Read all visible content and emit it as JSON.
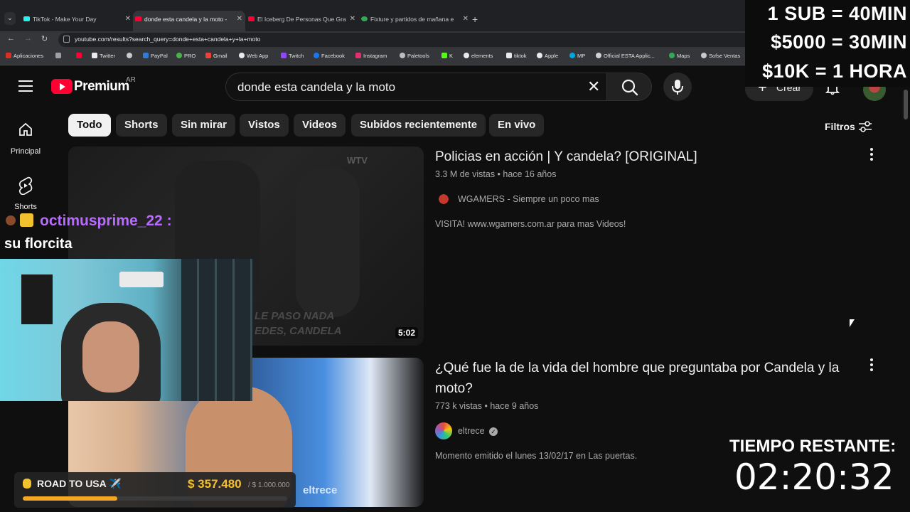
{
  "browser": {
    "tabs": [
      {
        "title": "TikTok - Make Your Day",
        "favicon_color": "#25f4ee",
        "active": false
      },
      {
        "title": "donde esta candela y la moto -",
        "favicon_color": "#ff0033",
        "active": true
      },
      {
        "title": "El Iceberg De Personas Que Gra",
        "favicon_color": "#ff0033",
        "active": false
      },
      {
        "title": "Fixture y partidos de mañana e",
        "favicon_color": "#34a853",
        "active": false
      }
    ],
    "url": "youtube.com/results?search_query=donde+esta+candela+y+la+moto",
    "bookmarks": [
      {
        "label": "Aplicaciones",
        "icon": "apps-grid-icon"
      },
      {
        "label": "",
        "icon": "youtube-icon"
      },
      {
        "label": "Twitter",
        "icon": "x-icon"
      },
      {
        "label": "",
        "icon": "generic-icon"
      },
      {
        "label": "PayPal",
        "icon": "paypal-icon"
      },
      {
        "label": "PRO",
        "icon": "pro-icon"
      },
      {
        "label": "Gmail",
        "icon": "gmail-icon"
      },
      {
        "label": "Web App",
        "icon": "whatsapp-icon"
      },
      {
        "label": "Twitch",
        "icon": "twitch-icon"
      },
      {
        "label": "Facebook",
        "icon": "facebook-icon"
      },
      {
        "label": "Instagram",
        "icon": "instagram-icon"
      },
      {
        "label": "Paletools",
        "icon": "paletools-icon"
      },
      {
        "label": "K",
        "icon": "kick-icon"
      },
      {
        "label": "elements",
        "icon": "elements-icon"
      },
      {
        "label": "tiktok",
        "icon": "tiktok-icon"
      },
      {
        "label": "Apple",
        "icon": "apple-icon"
      },
      {
        "label": "MP",
        "icon": "mercadopago-icon"
      },
      {
        "label": "Official ESTA Applic...",
        "icon": "esta-icon"
      },
      {
        "label": "Maps",
        "icon": "maps-icon"
      },
      {
        "label": "Sofse Ventas",
        "icon": "sofse-icon"
      }
    ]
  },
  "youtube": {
    "logo_text": "Premium",
    "country": "AR",
    "search_query": "donde esta candela y la moto",
    "create_label": "Crear",
    "sidebar": [
      {
        "label": "Principal",
        "icon": "home-icon"
      },
      {
        "label": "Shorts",
        "icon": "shorts-icon"
      }
    ],
    "chips": [
      "Todo",
      "Shorts",
      "Sin mirar",
      "Vistos",
      "Videos",
      "Subidos recientemente",
      "En vivo"
    ],
    "active_chip": "Todo",
    "filters_label": "Filtros",
    "results": [
      {
        "title": "Policias en acción | Y candela? [ORIGINAL]",
        "meta": "3.3 M de vistas • hace 16 años",
        "channel": "WGAMERS - Siempre un poco mas",
        "description": "VISITA! www.wgamers.com.ar para mas Videos!",
        "duration": "5:02",
        "thumb_caption_1": "LE PASO NADA",
        "thumb_caption_2": "EDES, CANDELA",
        "thumb_watermark": "WTV"
      },
      {
        "title": "¿Qué fue la de la vida del hombre que preguntaba por Candela y la moto?",
        "meta": "773 k vistas • hace 9 años",
        "channel": "eltrece",
        "verified": true,
        "description": "Momento emitido el lunes 13/02/17 en Las puertas.",
        "thumb_watermark": "eltrece"
      }
    ]
  },
  "overlay": {
    "sub_lines": [
      "1 SUB = 40MIN",
      "$5000 = 30MIN",
      "$10K = 1 HORA"
    ],
    "chat_username": "octimusprime_22",
    "chat_colon": ":",
    "chat_message": "su florcita",
    "goal_label": "ROAD TO USA ✈️",
    "goal_amount": "$ 357.480",
    "goal_target": "/ $ 1.000.000",
    "goal_progress": 0.357,
    "timer_label": "TIEMPO RESTANTE:",
    "timer_value": "02:20:32",
    "accent_purple": "#b86cff",
    "accent_gold": "#f2c12e"
  }
}
